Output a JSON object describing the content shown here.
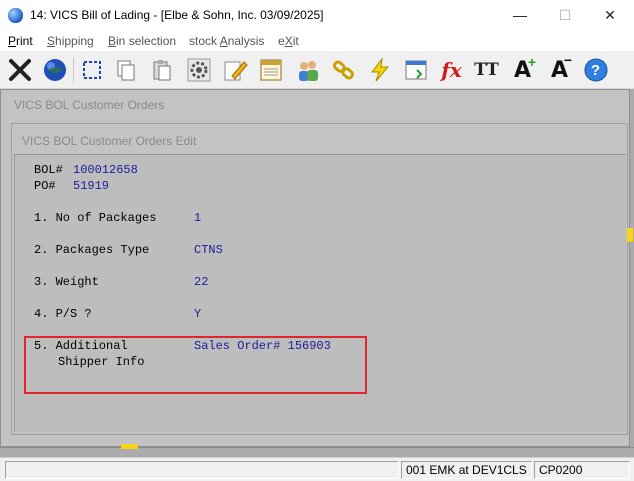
{
  "window": {
    "title": "14: VICS Bill of Lading - [Elbe & Sohn, Inc. 03/09/2025]",
    "minimize": "—",
    "maximize": "☐",
    "close": "✕"
  },
  "menu": {
    "items": [
      {
        "label": "Print",
        "accel": "P"
      },
      {
        "label": "Shipping",
        "accel": "S"
      },
      {
        "label": "Bin selection",
        "accel": "B"
      },
      {
        "label": "stock Analysis",
        "accel": "A"
      },
      {
        "label": "eXit",
        "accel": "X"
      }
    ]
  },
  "toolbar": {
    "icons": [
      "close-x-icon",
      "globe-icon",
      "select-box-icon",
      "copy-icon",
      "paste-icon",
      "settings-gear-icon",
      "edit-pencil-icon",
      "notes-icon",
      "users-icon",
      "link-chain-icon",
      "lightning-icon",
      "calendar-form-icon",
      "function-fx-icon",
      "font-type-icon",
      "font-increase-icon",
      "font-decrease-icon",
      "help-icon"
    ],
    "fx_label": "fx",
    "font_label": "TT",
    "font_plus_label": "A",
    "font_minus_label": "A",
    "help_label": "?"
  },
  "outer_window": {
    "title": "VICS BOL Customer Orders"
  },
  "inner_window": {
    "title": "VICS BOL Customer Orders Edit"
  },
  "form": {
    "bol_label": "BOL#",
    "bol_value": "100012658",
    "po_label": "PO#",
    "po_value": "51919",
    "fields": [
      {
        "label": "1. No of Packages",
        "value": "1"
      },
      {
        "label": "2. Packages Type",
        "value": "CTNS"
      },
      {
        "label": "3. Weight",
        "value": "22"
      },
      {
        "label": "4. P/S ?",
        "value": "Y"
      },
      {
        "label": "5. Additional",
        "label2": "Shipper Info",
        "value": "Sales Order# 156903"
      }
    ]
  },
  "statusbar": {
    "session": "001 EMK at DEV1CLS",
    "program": "CP0200"
  },
  "colors": {
    "value_text": "#1c1c9c",
    "highlight_border": "#e0262a",
    "panel_bg": "#bdbdbd"
  }
}
